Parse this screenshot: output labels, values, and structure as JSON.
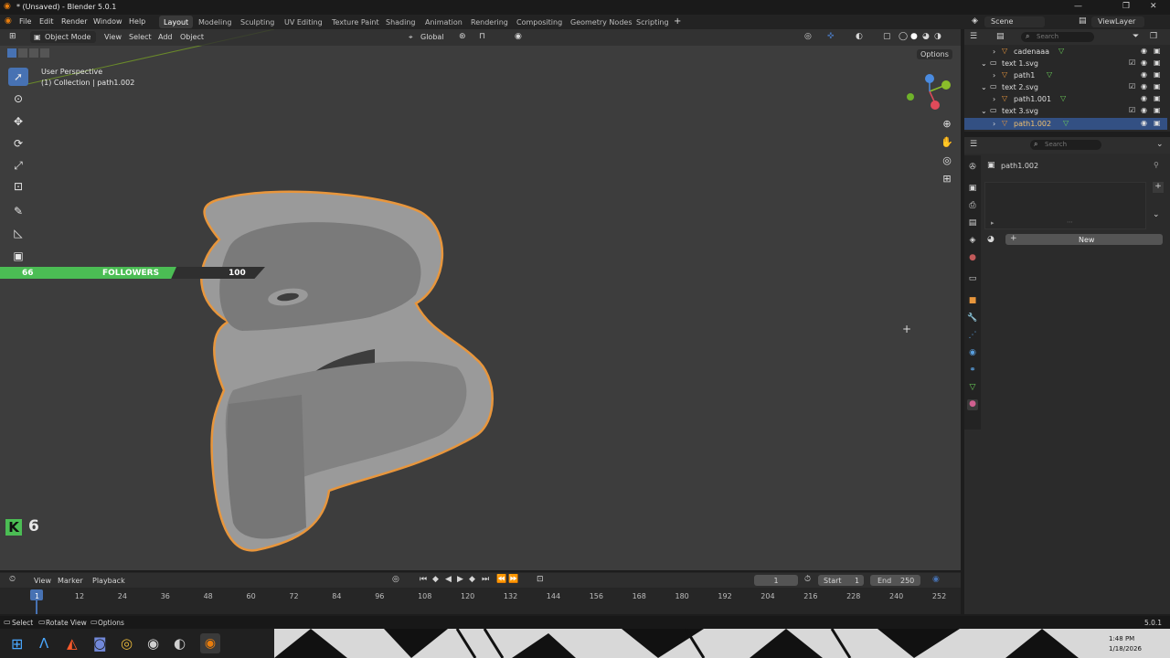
{
  "window": {
    "title": "* (Unsaved) - Blender 5.0.1"
  },
  "menu": [
    "File",
    "Edit",
    "Render",
    "Window",
    "Help"
  ],
  "workspaces": [
    {
      "label": "Layout",
      "active": true
    },
    {
      "label": "Modeling"
    },
    {
      "label": "Sculpting"
    },
    {
      "label": "UV Editing"
    },
    {
      "label": "Texture Paint"
    },
    {
      "label": "Shading"
    },
    {
      "label": "Animation"
    },
    {
      "label": "Rendering"
    },
    {
      "label": "Compositing"
    },
    {
      "label": "Geometry Nodes"
    },
    {
      "label": "Scripting"
    }
  ],
  "scene": {
    "name": "Scene",
    "view_layer": "ViewLayer"
  },
  "viewport": {
    "mode": "Object Mode",
    "menus": [
      "View",
      "Select",
      "Add",
      "Object"
    ],
    "orientation": "Global",
    "options_label": "Options",
    "overlay_title": "User Perspective",
    "overlay_subtitle": "(1) Collection | path1.002"
  },
  "overlay_widget": {
    "current": "66",
    "label": "FOLLOWERS",
    "goal": "100",
    "progress": 0.66,
    "kick_count": "6",
    "accent": "#4bbd54"
  },
  "outliner": {
    "search_placeholder": "Search",
    "rows": [
      {
        "label": "cadenaaa",
        "icon": "curve-icon",
        "indent": 1
      },
      {
        "label": "text 1.svg",
        "icon": "collection-icon",
        "indent": 0
      },
      {
        "label": "path1",
        "icon": "curve-icon",
        "indent": 1
      },
      {
        "label": "text 2.svg",
        "icon": "collection-icon",
        "indent": 0
      },
      {
        "label": "path1.001",
        "icon": "curve-icon",
        "indent": 1
      },
      {
        "label": "text 3.svg",
        "icon": "collection-icon",
        "indent": 0
      },
      {
        "label": "path1.002",
        "icon": "curve-icon",
        "indent": 1,
        "selected": true
      }
    ]
  },
  "properties": {
    "search_placeholder": "Search",
    "object_name": "path1.002",
    "new_label": "New"
  },
  "timeline": {
    "menus": [
      "View",
      "Marker",
      "Playback"
    ],
    "current_frame": "1",
    "start_label": "Start",
    "start": "1",
    "end_label": "End",
    "end": "250",
    "ticks": [
      "1",
      "12",
      "24",
      "36",
      "48",
      "60",
      "72",
      "84",
      "96",
      "108",
      "120",
      "132",
      "144",
      "156",
      "168",
      "180",
      "192",
      "204",
      "216",
      "228",
      "240",
      "252"
    ]
  },
  "statusbar": {
    "hints": [
      "Select",
      "Rotate View",
      "Options"
    ],
    "version": "5.0.1"
  },
  "taskbar": {
    "time": "1:48 PM",
    "date": "1/18/2026"
  }
}
